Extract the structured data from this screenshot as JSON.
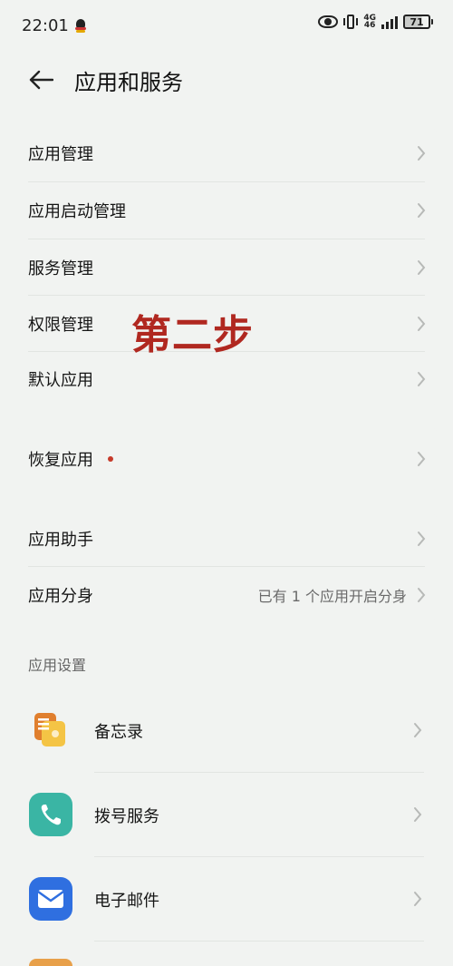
{
  "status_bar": {
    "time": "22:01",
    "network_top": "4G",
    "network_bottom": "46",
    "battery": "71"
  },
  "header": {
    "title": "应用和服务"
  },
  "group1": [
    {
      "label": "应用管理"
    },
    {
      "label": "应用启动管理"
    },
    {
      "label": "服务管理"
    },
    {
      "label": "权限管理"
    },
    {
      "label": "默认应用"
    }
  ],
  "group2": [
    {
      "label": "恢复应用"
    }
  ],
  "group3": [
    {
      "label": "应用助手",
      "value": ""
    },
    {
      "label": "应用分身",
      "value": "已有 1 个应用开启分身"
    }
  ],
  "section_title": "应用设置",
  "app_settings": [
    {
      "label": "备忘录",
      "icon": "memo-icon"
    },
    {
      "label": "拨号服务",
      "icon": "phone-icon"
    },
    {
      "label": "电子邮件",
      "icon": "mail-icon"
    }
  ],
  "annotation": "第二步",
  "colors": {
    "background": "#f1f3f1",
    "accent_red": "#b02820",
    "memo": "#e9a13a",
    "phone": "#3ab5a4",
    "mail": "#2f6fe0"
  }
}
